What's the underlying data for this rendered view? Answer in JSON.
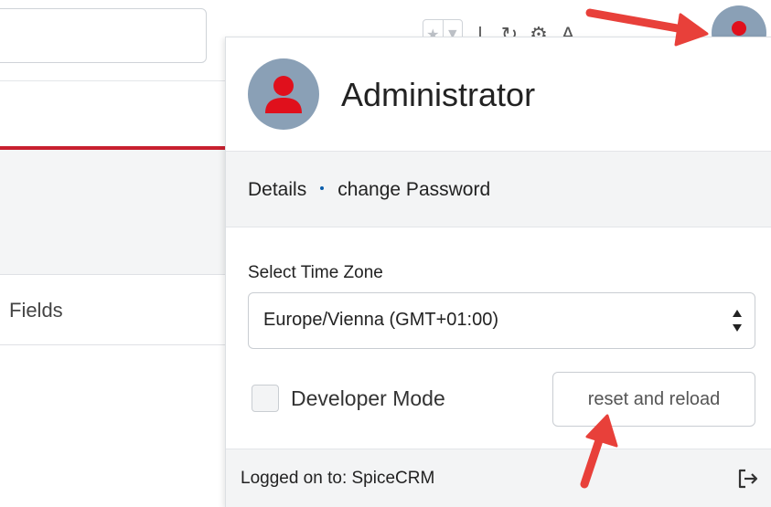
{
  "background": {
    "fields_label": "Fields"
  },
  "user": {
    "name": "Administrator"
  },
  "links": {
    "details": "Details",
    "change_password": "change Password"
  },
  "timezone": {
    "label": "Select Time Zone",
    "value": "Europe/Vienna (GMT+01:00)"
  },
  "developer_mode": {
    "label": "Developer Mode",
    "checked": false
  },
  "reset_button": {
    "label": "reset and reload"
  },
  "footer": {
    "logged_on_text": "Logged on to: SpiceCRM"
  },
  "icons": {
    "avatar": "user-avatar-icon",
    "logout": "logout-icon",
    "select_arrows": "select-arrows-icon",
    "star": "star-icon",
    "caret": "caret-down-icon",
    "refresh": "refresh-icon",
    "gear": "gear-icon",
    "font": "font-size-icon",
    "annotation_arrow": "annotation-arrow-icon"
  },
  "colors": {
    "accent_red": "#c8202f",
    "avatar_bg": "#8aa0b6",
    "avatar_figure": "#e0101c",
    "annotation_arrow": "#e8403a",
    "panel_gray": "#f3f4f5",
    "link_dot": "#0a5dab"
  }
}
